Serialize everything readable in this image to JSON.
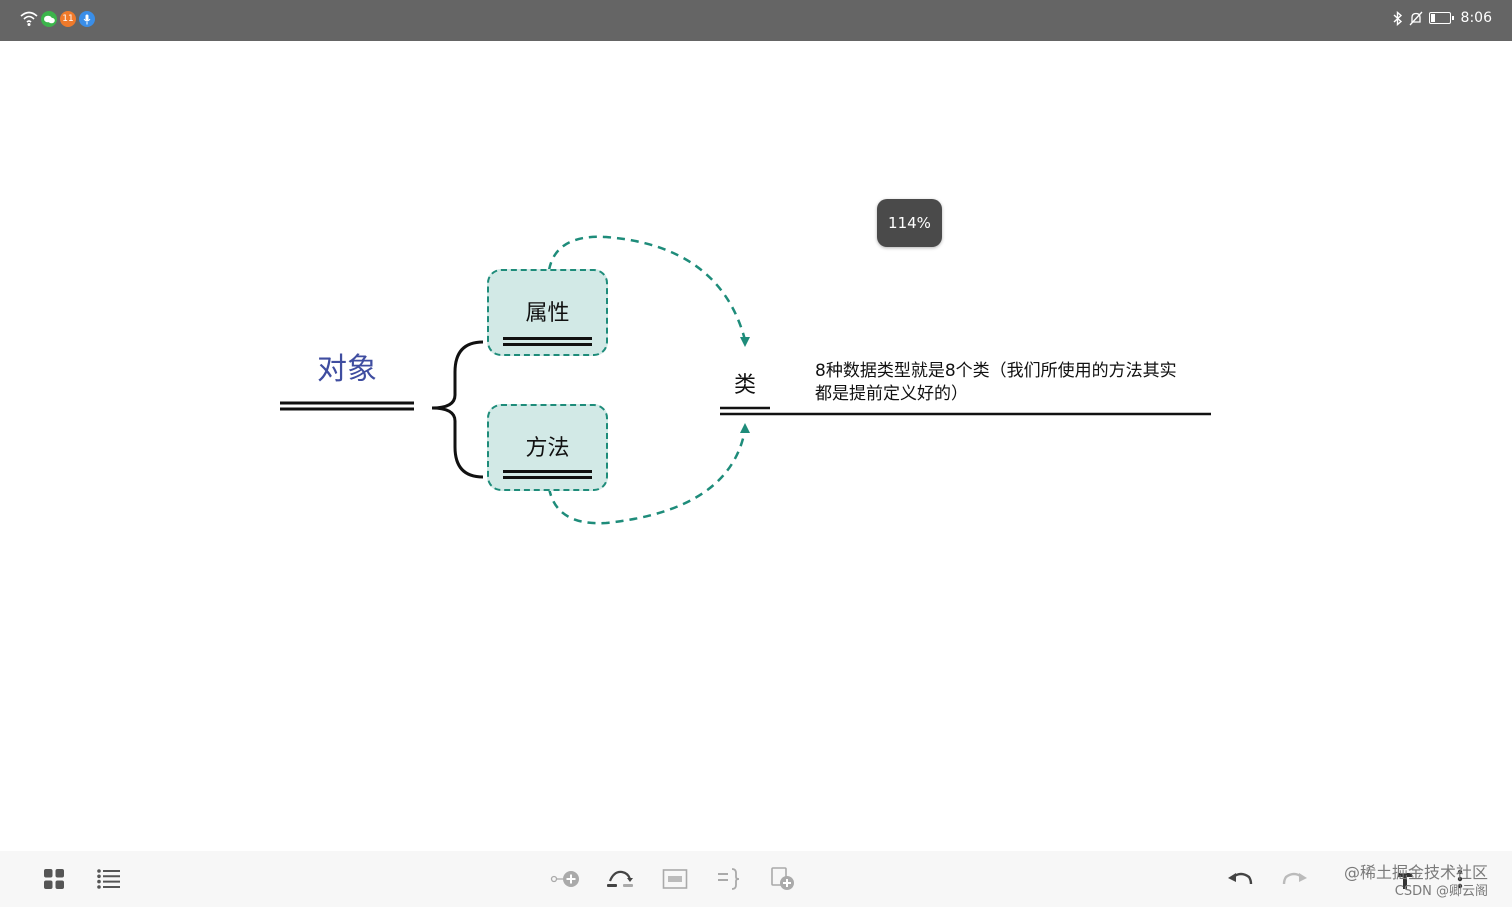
{
  "status_bar": {
    "notification_badge": "11",
    "time": "8:06"
  },
  "zoom": "114%",
  "mindmap": {
    "root": "对象",
    "children": [
      "属性",
      "方法"
    ],
    "target": "类",
    "note_line1": "8种数据类型就是8个类（我们所使用的方法其实",
    "note_line2": "都是提前定义好的）"
  },
  "toolbar": {
    "left_icons": [
      "grid-view-icon",
      "outline-list-icon"
    ],
    "center_icons": [
      "add-child-topic-icon",
      "relationship-icon",
      "summary-box-icon",
      "bracket-summary-icon",
      "insert-topic-icon"
    ],
    "right_icons": [
      "undo-icon",
      "redo-icon",
      "format-icon",
      "more-icon"
    ]
  },
  "watermark": {
    "line1": "@稀土掘金技术社区",
    "line2": "CSDN @卿云阁"
  },
  "colors": {
    "accent": "#1e8c7a",
    "node_fill": "#d2e9e6",
    "root_text": "#3f4da0",
    "status_bar": "#656565",
    "zoom_pill": "#4a4a4a"
  }
}
